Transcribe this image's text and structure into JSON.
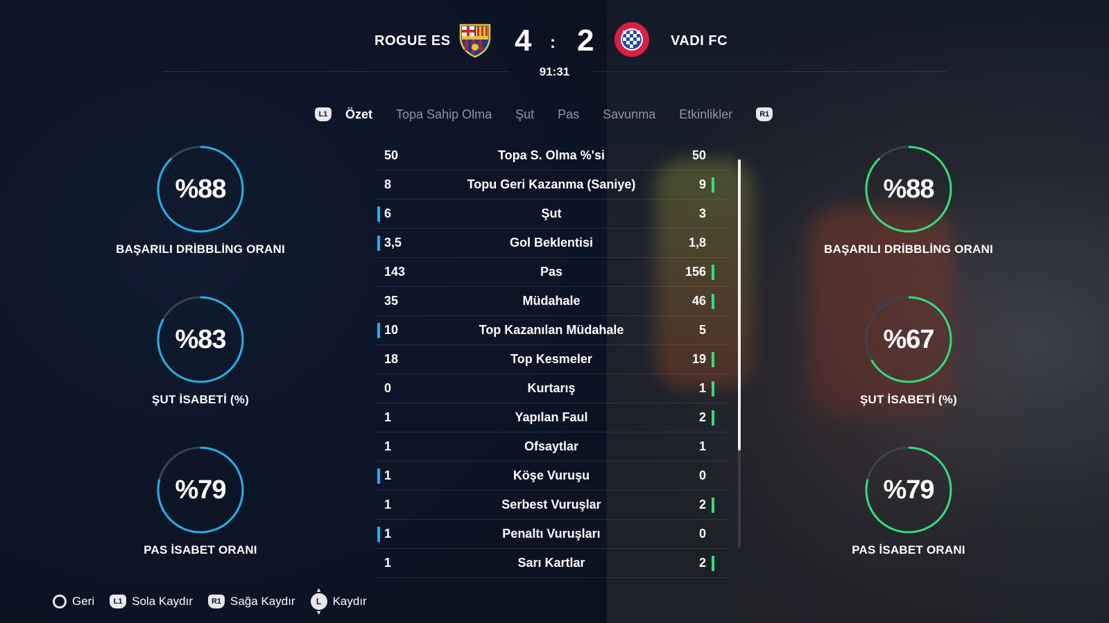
{
  "match": {
    "home_team": "ROGUE ES",
    "away_team": "VADI FC",
    "home_score": "4",
    "away_score": "2",
    "separator": ":",
    "time": "91:31"
  },
  "tabs": {
    "left_button": "L1",
    "right_button": "R1",
    "items": [
      "Özet",
      "Topa Sahip Olma",
      "Şut",
      "Pas",
      "Savunma",
      "Etkinlikler"
    ],
    "active": "Özet"
  },
  "home_circles": [
    {
      "value": "%88",
      "label": "BAŞARILI DRİBBLİNG ORANI",
      "percent": 88
    },
    {
      "value": "%83",
      "label": "ŞUT İSABETİ (%)",
      "percent": 83
    },
    {
      "value": "%79",
      "label": "PAS İSABET ORANI",
      "percent": 79
    }
  ],
  "away_circles": [
    {
      "value": "%88",
      "label": "BAŞARILI DRİBBLİNG ORANI",
      "percent": 88
    },
    {
      "value": "%67",
      "label": "ŞUT İSABETİ (%)",
      "percent": 67
    },
    {
      "value": "%79",
      "label": "PAS İSABET ORANI",
      "percent": 79
    }
  ],
  "stats": [
    {
      "name": "Topa S. Olma %'si",
      "home": "50",
      "away": "50",
      "leader": "none"
    },
    {
      "name": "Topu Geri Kazanma (Saniye)",
      "home": "8",
      "away": "9",
      "leader": "away"
    },
    {
      "name": "Şut",
      "home": "6",
      "away": "3",
      "leader": "home"
    },
    {
      "name": "Gol Beklentisi",
      "home": "3,5",
      "away": "1,8",
      "leader": "home"
    },
    {
      "name": "Pas",
      "home": "143",
      "away": "156",
      "leader": "away"
    },
    {
      "name": "Müdahale",
      "home": "35",
      "away": "46",
      "leader": "away"
    },
    {
      "name": "Top Kazanılan Müdahale",
      "home": "10",
      "away": "5",
      "leader": "home"
    },
    {
      "name": "Top Kesmeler",
      "home": "18",
      "away": "19",
      "leader": "away"
    },
    {
      "name": "Kurtarış",
      "home": "0",
      "away": "1",
      "leader": "away"
    },
    {
      "name": "Yapılan Faul",
      "home": "1",
      "away": "2",
      "leader": "away"
    },
    {
      "name": "Ofsaytlar",
      "home": "1",
      "away": "1",
      "leader": "none"
    },
    {
      "name": "Köşe Vuruşu",
      "home": "1",
      "away": "0",
      "leader": "home"
    },
    {
      "name": "Serbest Vuruşlar",
      "home": "1",
      "away": "2",
      "leader": "away"
    },
    {
      "name": "Penaltı Vuruşları",
      "home": "1",
      "away": "0",
      "leader": "home"
    },
    {
      "name": "Sarı Kartlar",
      "home": "1",
      "away": "2",
      "leader": "away"
    }
  ],
  "footer": {
    "back_label": "Geri",
    "l1": "L1",
    "scroll_left_label": "Sola Kaydır",
    "r1": "R1",
    "scroll_right_label": "Sağa Kaydır",
    "stick": "L",
    "scroll_label": "Kaydır"
  },
  "colors": {
    "home_accent": "#22b0e8",
    "away_accent": "#2fe07a",
    "ring_track": "#3a4356"
  }
}
